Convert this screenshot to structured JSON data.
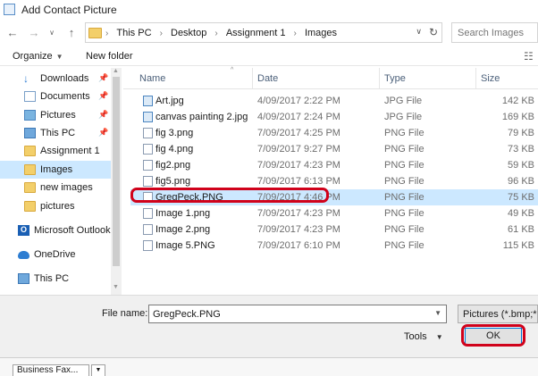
{
  "window": {
    "title": "Add Contact Picture"
  },
  "address": {
    "crumbs": [
      "This PC",
      "Desktop",
      "Assignment 1",
      "Images"
    ],
    "search_placeholder": "Search Images"
  },
  "toolbar": {
    "organize": "Organize",
    "new_folder": "New folder"
  },
  "nav": {
    "items": [
      {
        "label": "Downloads",
        "icon": "download-icon",
        "pinned": true
      },
      {
        "label": "Documents",
        "icon": "documents-icon",
        "pinned": true
      },
      {
        "label": "Pictures",
        "icon": "pictures-icon",
        "pinned": true
      },
      {
        "label": "This PC",
        "icon": "computer-icon",
        "pinned": true
      },
      {
        "label": "Assignment 1",
        "icon": "folder-icon",
        "pinned": false
      },
      {
        "label": "Images",
        "icon": "folder-icon",
        "pinned": false,
        "selected": true
      },
      {
        "label": "new images",
        "icon": "folder-icon",
        "pinned": false
      },
      {
        "label": "pictures",
        "icon": "folder-icon",
        "pinned": false
      },
      {
        "label": "Microsoft Outlook",
        "icon": "outlook-icon",
        "pinned": false
      },
      {
        "label": "OneDrive",
        "icon": "onedrive-icon",
        "pinned": false
      },
      {
        "label": "This PC",
        "icon": "computer-icon",
        "pinned": false
      }
    ]
  },
  "columns": {
    "name": "Name",
    "date": "Date",
    "type": "Type",
    "size": "Size"
  },
  "files": [
    {
      "name": "Art.jpg",
      "date": "4/09/2017 2:22 PM",
      "type": "JPG File",
      "size": "142 KB"
    },
    {
      "name": "canvas painting 2.jpg",
      "date": "4/09/2017 2:24 PM",
      "type": "JPG File",
      "size": "169 KB"
    },
    {
      "name": "fig 3.png",
      "date": "7/09/2017 4:25 PM",
      "type": "PNG File",
      "size": "79 KB"
    },
    {
      "name": "fig 4.png",
      "date": "7/09/2017 9:27 PM",
      "type": "PNG File",
      "size": "73 KB"
    },
    {
      "name": "fig2.png",
      "date": "7/09/2017 4:23 PM",
      "type": "PNG File",
      "size": "59 KB"
    },
    {
      "name": "fig5.png",
      "date": "7/09/2017 6:13 PM",
      "type": "PNG File",
      "size": "96 KB"
    },
    {
      "name": "GregPeck.PNG",
      "date": "7/09/2017 4:46 PM",
      "type": "PNG File",
      "size": "75 KB"
    },
    {
      "name": "Image 1.png",
      "date": "7/09/2017 4:23 PM",
      "type": "PNG File",
      "size": "49 KB"
    },
    {
      "name": "Image 2.png",
      "date": "7/09/2017 4:23 PM",
      "type": "PNG File",
      "size": "61 KB"
    },
    {
      "name": "Image 5.PNG",
      "date": "7/09/2017 6:10 PM",
      "type": "PNG File",
      "size": "115 KB"
    }
  ],
  "bottom": {
    "file_name_label": "File name:",
    "file_name_value": "GregPeck.PNG",
    "filter": "Pictures (*.bmp;*.e",
    "tools": "Tools",
    "ok": "OK"
  },
  "behind": {
    "field": "Business Fax..."
  },
  "colors": {
    "selection": "#cce8ff",
    "annotation": "#d0021b",
    "accent": "#0078d7"
  }
}
